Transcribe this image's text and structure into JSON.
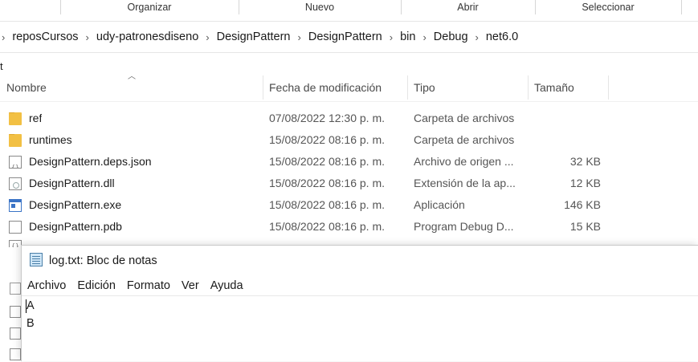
{
  "ribbon": {
    "groups": [
      "Organizar",
      "Nuevo",
      "Abrir",
      "Seleccionar"
    ]
  },
  "breadcrumb": [
    "reposCursos",
    "udy-patronesdiseno",
    "DesignPattern",
    "DesignPattern",
    "bin",
    "Debug",
    "net6.0"
  ],
  "quick_access_stub": "t",
  "columns": {
    "name": "Nombre",
    "date": "Fecha de modificación",
    "type": "Tipo",
    "size": "Tamaño"
  },
  "files": [
    {
      "icon": "folder-icon",
      "name": "ref",
      "date": "07/08/2022 12:30 p. m.",
      "type": "Carpeta de archivos",
      "size": ""
    },
    {
      "icon": "folder-icon",
      "name": "runtimes",
      "date": "15/08/2022 08:16 p. m.",
      "type": "Carpeta de archivos",
      "size": ""
    },
    {
      "icon": "json-file-icon",
      "name": "DesignPattern.deps.json",
      "date": "15/08/2022 08:16 p. m.",
      "type": "Archivo de origen ...",
      "size": "32 KB"
    },
    {
      "icon": "dll-file-icon",
      "name": "DesignPattern.dll",
      "date": "15/08/2022 08:16 p. m.",
      "type": "Extensión de la ap...",
      "size": "12 KB"
    },
    {
      "icon": "exe-file-icon",
      "name": "DesignPattern.exe",
      "date": "15/08/2022 08:16 p. m.",
      "type": "Aplicación",
      "size": "146 KB"
    },
    {
      "icon": "pdb-file-icon",
      "name": "DesignPattern.pdb",
      "date": "15/08/2022 08:16 p. m.",
      "type": "Program Debug D...",
      "size": "15 KB"
    }
  ],
  "notepad": {
    "title": "log.txt: Bloc de notas",
    "menu": [
      "Archivo",
      "Edición",
      "Formato",
      "Ver",
      "Ayuda"
    ],
    "lines": [
      "A",
      "B"
    ]
  },
  "colors": {
    "folder": "#f2c044",
    "exe_accent": "#3b74c6"
  }
}
